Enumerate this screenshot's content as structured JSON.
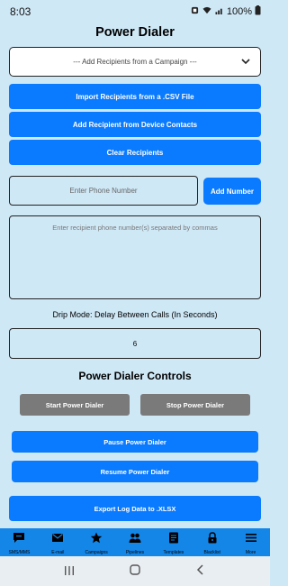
{
  "status": {
    "time": "8:03",
    "battery": "100%"
  },
  "title": "Power Dialer",
  "campaign_select": {
    "selected": "--- Add Recipients from a Campaign ---"
  },
  "buttons": {
    "import_csv": "Import Recipients from a .CSV File",
    "add_contacts": "Add Recipient from Device Contacts",
    "clear": "Clear Recipients",
    "add_number": "Add Number",
    "start": "Start Power Dialer",
    "stop": "Stop Power Dialer",
    "pause": "Pause Power Dialer",
    "resume": "Resume Power Dialer",
    "export": "Export Log Data to .XLSX"
  },
  "phone_input": {
    "placeholder": "Enter Phone Number"
  },
  "recipients_area": {
    "placeholder": "Enter recipient phone number(s) separated by commas"
  },
  "drip": {
    "label": "Drip Mode: Delay Between Calls (In Seconds)",
    "value": "6"
  },
  "controls_title": "Power Dialer Controls",
  "tabs": [
    {
      "label": "SMS/MMS",
      "icon": "chat-icon"
    },
    {
      "label": "E-mail",
      "icon": "mail-icon"
    },
    {
      "label": "Campaigns",
      "icon": "star-icon"
    },
    {
      "label": "Pipelines",
      "icon": "people-icon"
    },
    {
      "label": "Templates",
      "icon": "document-icon"
    },
    {
      "label": "Blacklist",
      "icon": "lock-icon"
    },
    {
      "label": "More",
      "icon": "menu-icon"
    }
  ],
  "colors": {
    "background": "#cfe8f6",
    "primary": "#0a7aff",
    "secondary": "#7a7a7a",
    "tab_bar": "#1486e8"
  }
}
